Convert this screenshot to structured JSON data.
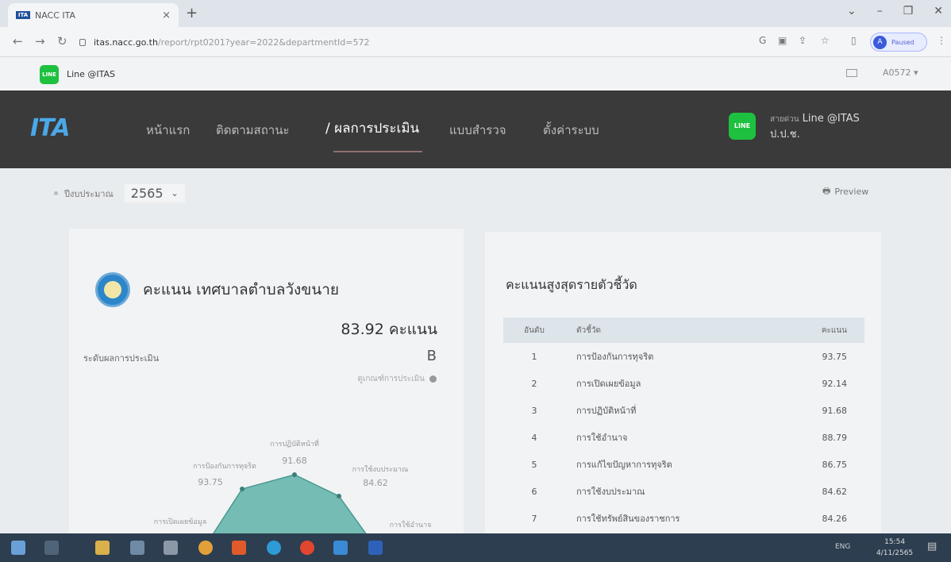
{
  "browser": {
    "tab_title": "NACC ITA",
    "tab_favicon": "ITA",
    "url_host": "itas.nacc.go.th",
    "url_path": "/report/rpt0201?year=2022&departmentId=572",
    "profile_initial": "A",
    "profile_status": "Paused",
    "new_tab": "+",
    "close_tab": "×"
  },
  "topbar": {
    "line_label": "Line @ITAS",
    "line_badge": "LINE",
    "account": "A0572 ▾"
  },
  "nav": {
    "logo": "ITA",
    "items": [
      "หน้าแรก",
      "ติดตามสถานะ",
      "/ ผลการประเมิน",
      "แบบสำรวจ",
      "ตั้งค่าระบบ"
    ],
    "hotline_prefix": "สายด่วน",
    "hotline_name": "Line @ITAS",
    "hotline_org": "ป.ป.ช."
  },
  "filter": {
    "year_label": "ปีงบประมาณ",
    "year_value": "2565",
    "preview_label": "Preview"
  },
  "summary": {
    "org_title": "คะแนน เทศบาลตำบลวังขนาย",
    "score_text": "83.92 คะแนน",
    "level_label": "ระดับผลการประเมิน",
    "level_value": "B",
    "criteria_link": "ดูเกณฑ์การประเมิน"
  },
  "radar": {
    "points": [
      {
        "label": "การปฏิบัติหน้าที่",
        "value": "91.68"
      },
      {
        "label": "การป้องกันการทุจริต",
        "value": "93.75"
      },
      {
        "label": "การใช้งบประมาณ",
        "value": "84.62"
      },
      {
        "label": "การเปิดเผยข้อมูล",
        "value": ""
      },
      {
        "label": "การใช้อำนาจ",
        "value": ""
      }
    ]
  },
  "ranking": {
    "title": "คะแนนสูงสุดรายตัวชี้วัด",
    "headers": [
      "อันดับ",
      "ตัวชี้วัด",
      "คะแนน"
    ],
    "rows": [
      {
        "rank": "1",
        "name": "การป้องกันการทุจริต",
        "score": "93.75"
      },
      {
        "rank": "2",
        "name": "การเปิดเผยข้อมูล",
        "score": "92.14"
      },
      {
        "rank": "3",
        "name": "การปฏิบัติหน้าที่",
        "score": "91.68"
      },
      {
        "rank": "4",
        "name": "การใช้อำนาจ",
        "score": "88.79"
      },
      {
        "rank": "5",
        "name": "การแก้ไขปัญหาการทุจริต",
        "score": "86.75"
      },
      {
        "rank": "6",
        "name": "การใช้งบประมาณ",
        "score": "84.62"
      },
      {
        "rank": "7",
        "name": "การใช้ทรัพย์สินของราชการ",
        "score": "84.26"
      }
    ]
  },
  "taskbar": {
    "tray_text": "ENG",
    "time": "15:54",
    "date": "4/11/2565"
  },
  "colors": {
    "nav_bg": "#3a3a3a",
    "line_green": "#1ec13f",
    "radar_fill": "#5fb3a8",
    "taskbar": "#2c3e50"
  }
}
